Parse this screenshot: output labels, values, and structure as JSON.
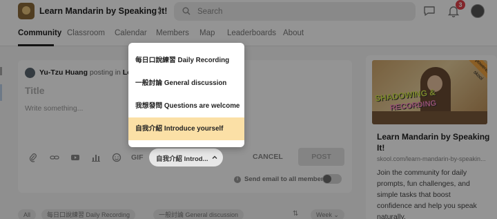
{
  "header": {
    "app_title": "Learn Mandarin by Speaking It!",
    "search_placeholder": "Search",
    "notification_count": "3"
  },
  "nav": {
    "items": [
      {
        "label": "Community",
        "active": true
      },
      {
        "label": "Classroom"
      },
      {
        "label": "Calendar"
      },
      {
        "label": "Members"
      },
      {
        "label": "Map"
      },
      {
        "label": "Leaderboards"
      },
      {
        "label": "About"
      }
    ]
  },
  "composer": {
    "author_name": "Yu-Tzu Huang",
    "posting_in_prefix": "posting in",
    "posting_in_target": "Lea",
    "title_placeholder": "Title",
    "body_placeholder": "Write something...",
    "gif_label": "GIF",
    "category_value": "自我介紹 Introd...",
    "cancel_label": "CANCEL",
    "post_label": "POST",
    "info_icon": "i",
    "email_label": "Send email to all members"
  },
  "dropdown": {
    "options": [
      {
        "label": "每日口說練習 Daily Recording"
      },
      {
        "label": "一般討論 General discussion"
      },
      {
        "label": "我想發問 Questions are welcome"
      },
      {
        "label": "自我介紹 Introduce yourself",
        "selected": true
      }
    ]
  },
  "filters": {
    "chips": [
      {
        "label": "All"
      },
      {
        "label": "每日口說練習 Daily Recording"
      },
      {
        "label": "一般討論 General discussion"
      }
    ],
    "sort_label": "Week"
  },
  "side_card": {
    "cover_text_1": "SHADOWING &",
    "cover_text_2": "RECORDING",
    "ribbon": "powered by skool",
    "title": "Learn Mandarin by Speaking It!",
    "url": "skool.com/learn-mandarin-by-speakin...",
    "description": "Join the community for daily prompts, fun challenges, and simple tasks that boost confidence and help you speak naturally."
  },
  "colors": {
    "overlay": "#000000",
    "selected_option_bg": "#fbe0a6",
    "badge": "#e0434b"
  }
}
